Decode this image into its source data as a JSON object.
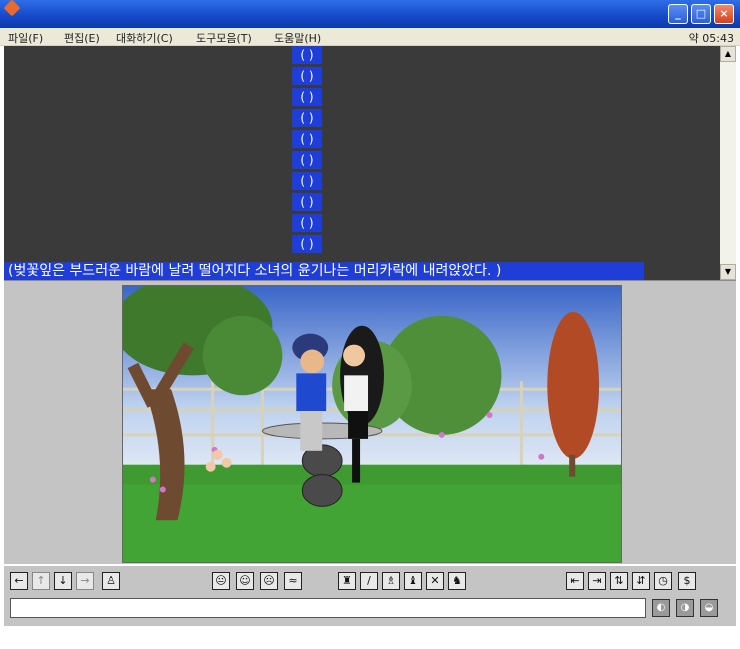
{
  "window": {
    "title": "",
    "buttons": {
      "minimize": "_",
      "maximize": "□",
      "close": "×"
    }
  },
  "menu": {
    "items": [
      "파일(F)",
      "편집(E)",
      "대화하기(C)",
      "도구모음(T)",
      "도움말(H)"
    ],
    "clock": "약 05:43"
  },
  "chat": {
    "bubble_lines": [
      "( )",
      "( )",
      "( )",
      "( )",
      "( )",
      "( )",
      "( )",
      "( )",
      "( )",
      "( )"
    ],
    "narration": "(벚꽃잎은 부드러운 바람에 날려 떨어지다 소녀의 윤기나는 머리카락에 내려앉았다. )"
  },
  "scrollbar": {
    "up": "▲",
    "down": "▼"
  },
  "toolbar": {
    "move": [
      "←",
      "↑",
      "↓",
      "→"
    ],
    "stand": "♙",
    "faces": [
      "😐",
      "☺",
      "☹",
      "≈"
    ],
    "poses": [
      "♜",
      "/",
      "♗",
      "♝",
      "✕",
      "♞"
    ],
    "right": [
      "⇤",
      "⇥",
      "⇅",
      "⇵",
      "◷",
      "$"
    ]
  },
  "input": {
    "value": "",
    "placeholder": "",
    "send_buttons": [
      "◐",
      "◑",
      "◒"
    ]
  },
  "colors": {
    "chat_bg": "#3a3a3a",
    "highlight": "#1f3ed8",
    "panel": "#c4c4c4",
    "titlebar": "#1648c8"
  }
}
